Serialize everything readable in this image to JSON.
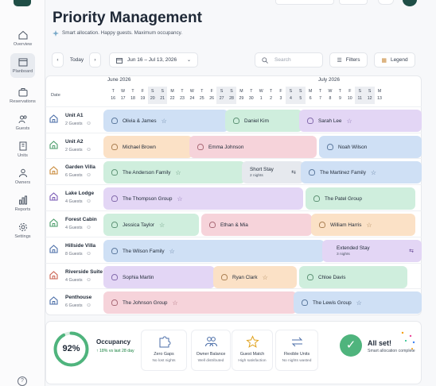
{
  "nav": [
    {
      "label": "Overview",
      "icon": "home-icon"
    },
    {
      "label": "Planboard",
      "icon": "calendar-icon",
      "active": true
    },
    {
      "label": "Reservations",
      "icon": "suitcase-icon"
    },
    {
      "label": "Guests",
      "icon": "users-icon"
    },
    {
      "label": "Units",
      "icon": "building-icon"
    },
    {
      "label": "Owners",
      "icon": "owners-icon"
    },
    {
      "label": "Reports",
      "icon": "bar-chart-icon"
    },
    {
      "label": "Settings",
      "icon": "gear-icon"
    }
  ],
  "help_label": "?",
  "header": {
    "title": "Priority Management",
    "subtitle": "Smart allocation. Happy guests. Maximum occupancy."
  },
  "toolbar": {
    "today": "Today",
    "date_range": "Jun 16 – Jul 13, 2026",
    "search_placeholder": "Search",
    "filters": "Filters",
    "legend": "Legend"
  },
  "calendar": {
    "date_label": "Date",
    "months": [
      {
        "label": "June 2026"
      },
      {
        "label": "July 2026"
      }
    ],
    "days": [
      {
        "w": "T",
        "d": "16"
      },
      {
        "w": "W",
        "d": "17"
      },
      {
        "w": "T",
        "d": "18"
      },
      {
        "w": "F",
        "d": "19"
      },
      {
        "w": "S",
        "d": "20",
        "we": true
      },
      {
        "w": "S",
        "d": "21",
        "we": true
      },
      {
        "w": "M",
        "d": "22"
      },
      {
        "w": "T",
        "d": "23"
      },
      {
        "w": "W",
        "d": "24"
      },
      {
        "w": "T",
        "d": "25"
      },
      {
        "w": "F",
        "d": "26"
      },
      {
        "w": "S",
        "d": "27",
        "we": true
      },
      {
        "w": "S",
        "d": "28",
        "we": true
      },
      {
        "w": "M",
        "d": "29"
      },
      {
        "w": "T",
        "d": "30"
      },
      {
        "w": "W",
        "d": "1"
      },
      {
        "w": "T",
        "d": "2"
      },
      {
        "w": "F",
        "d": "3"
      },
      {
        "w": "S",
        "d": "4",
        "we": true
      },
      {
        "w": "S",
        "d": "5",
        "we": true
      },
      {
        "w": "M",
        "d": "6"
      },
      {
        "w": "T",
        "d": "7"
      },
      {
        "w": "W",
        "d": "8"
      },
      {
        "w": "T",
        "d": "9"
      },
      {
        "w": "F",
        "d": "10"
      },
      {
        "w": "S",
        "d": "11",
        "we": true
      },
      {
        "w": "S",
        "d": "12",
        "we": true
      },
      {
        "w": "M",
        "d": "13"
      }
    ]
  },
  "units": [
    {
      "name": "Unit A1",
      "guests": "2 Guests",
      "color": "#4b6ea8"
    },
    {
      "name": "Unit A2",
      "guests": "2 Guests",
      "color": "#4a9c6a"
    },
    {
      "name": "Garden Villa",
      "guests": "6 Guests",
      "color": "#c98a3a"
    },
    {
      "name": "Lake Lodge",
      "guests": "4 Guests",
      "color": "#7a5ab5"
    },
    {
      "name": "Forest Cabin",
      "guests": "4 Guests",
      "color": "#4a9c6a"
    },
    {
      "name": "Hillside Villa",
      "guests": "8 Guests",
      "color": "#4b6ea8"
    },
    {
      "name": "Riverside Suite",
      "guests": "4 Guests",
      "color": "#c9604f"
    },
    {
      "name": "Penthouse",
      "guests": "6 Guests",
      "color": "#4b6ea8"
    }
  ],
  "bookings": [
    [
      {
        "name": "Olivia & James",
        "color": "blue",
        "star": true
      },
      {
        "name": "Daniel Kim",
        "color": "green"
      },
      {
        "name": "Sarah Lee",
        "color": "purple",
        "star": true
      }
    ],
    [
      {
        "name": "Michael Brown",
        "color": "peach"
      },
      {
        "name": "Emma Johnson",
        "color": "pink"
      },
      {
        "name": "Noah Wilson",
        "color": "blue"
      }
    ],
    [
      {
        "name": "The Anderson Family",
        "color": "green",
        "star": true
      },
      {
        "name": "Short Stay",
        "sub": "2 nights",
        "color": "gray",
        "arrows": true
      },
      {
        "name": "The Martinez Family",
        "color": "blue",
        "star": true
      }
    ],
    [
      {
        "name": "The Thompson Group",
        "color": "purple",
        "star": true
      },
      {
        "name": "The Patel Group",
        "color": "green"
      }
    ],
    [
      {
        "name": "Jessica Taylor",
        "color": "green",
        "star": true
      },
      {
        "name": "Ethan & Mia",
        "color": "pink"
      },
      {
        "name": "William Harris",
        "color": "peach",
        "star": true
      }
    ],
    [
      {
        "name": "The Wilson Family",
        "color": "blue",
        "star": true
      },
      {
        "name": "Extended Stay",
        "sub": "3 nights",
        "color": "purple",
        "arrows": true
      }
    ],
    [
      {
        "name": "Sophia Martin",
        "color": "purple"
      },
      {
        "name": "Ryan Clark",
        "color": "peach",
        "star": true
      },
      {
        "name": "Chloe Davis",
        "color": "green"
      }
    ],
    [
      {
        "name": "The Johnson Group",
        "color": "pink",
        "star": true
      },
      {
        "name": "The Lewis Group",
        "color": "blue",
        "star": true
      }
    ]
  ],
  "summary": {
    "occupancy_value": "92%",
    "occupancy_fraction": 0.92,
    "occupancy_label": "Occupancy",
    "occupancy_delta": "↑ 18% vs last 28 day",
    "metrics": [
      {
        "title": "Zero Gaps",
        "sub": "No lost nights",
        "icon": "puzzle-icon"
      },
      {
        "title": "Owner Balance",
        "sub": "Well distributed",
        "icon": "owners-icon"
      },
      {
        "title": "Guest Match",
        "sub": "High satisfaction",
        "icon": "star-icon"
      },
      {
        "title": "Flexible Units",
        "sub": "No nights wasted",
        "icon": "swap-icon"
      }
    ],
    "allset_title": "All set!",
    "allset_sub": "Smart allocation complete"
  }
}
